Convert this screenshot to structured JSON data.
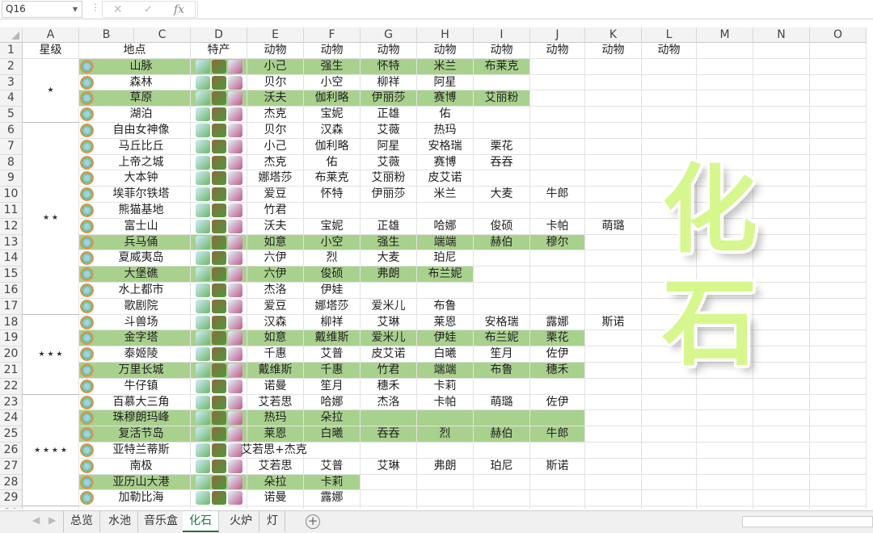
{
  "formula_bar": {
    "name_box": "Q16",
    "cancel": "✕",
    "enter": "✓",
    "fx": "fx"
  },
  "columns": [
    "A",
    "B",
    "C",
    "D",
    "E",
    "F",
    "G",
    "H",
    "I",
    "J",
    "K",
    "L",
    "M",
    "N",
    "O"
  ],
  "header_row": {
    "star": "星级",
    "place": "地点",
    "specialty": "特产",
    "animal": "动物",
    "animal_cols": 8
  },
  "star_groups": [
    {
      "label": "★",
      "from": 2,
      "to": 5
    },
    {
      "label": "★ ★",
      "from": 6,
      "to": 17
    },
    {
      "label": "★ ★ ★",
      "from": 18,
      "to": 22
    },
    {
      "label": "★ ★ ★ ★",
      "from": 23,
      "to": 29
    }
  ],
  "rows": [
    {
      "place": "山脉",
      "animals": [
        "小己",
        "强生",
        "怀特",
        "米兰",
        "布莱克"
      ],
      "highlight_through": "I"
    },
    {
      "place": "森林",
      "animals": [
        "贝尔",
        "小空",
        "柳祥",
        "阿星"
      ]
    },
    {
      "place": "草原",
      "animals": [
        "沃夫",
        "伽利略",
        "伊丽莎",
        "赛博",
        "艾丽粉"
      ],
      "highlight_through": "I"
    },
    {
      "place": "湖泊",
      "animals": [
        "杰克",
        "宝妮",
        "正雄",
        "佑"
      ]
    },
    {
      "place": "自由女神像",
      "animals": [
        "贝尔",
        "汉森",
        "艾薇",
        "热玛"
      ]
    },
    {
      "place": "马丘比丘",
      "animals": [
        "小己",
        "伽利略",
        "阿星",
        "安格瑞",
        "栗花"
      ]
    },
    {
      "place": "上帝之城",
      "animals": [
        "杰克",
        "佑",
        "艾薇",
        "赛博",
        "吞吞"
      ]
    },
    {
      "place": "大本钟",
      "animals": [
        "娜塔莎",
        "布莱克",
        "艾丽粉",
        "皮艾诺"
      ]
    },
    {
      "place": "埃菲尔铁塔",
      "animals": [
        "爱豆",
        "怀特",
        "伊丽莎",
        "米兰",
        "大麦",
        "牛郎"
      ]
    },
    {
      "place": "熊猫基地",
      "animals": [
        "竹君"
      ]
    },
    {
      "place": "富士山",
      "animals": [
        "沃夫",
        "宝妮",
        "正雄",
        "哈娜",
        "俊硕",
        "卡帕",
        "萌璐"
      ]
    },
    {
      "place": "兵马俑",
      "animals": [
        "如意",
        "小空",
        "强生",
        "端端",
        "赫伯",
        "穆尔"
      ],
      "highlight_through": "J"
    },
    {
      "place": "夏威夷岛",
      "animals": [
        "六伊",
        "烈",
        "大麦",
        "珀尼"
      ]
    },
    {
      "place": "大堡礁",
      "animals": [
        "六伊",
        "俊硕",
        "弗朗",
        "布兰妮"
      ],
      "highlight_through": "H"
    },
    {
      "place": "水上都市",
      "animals": [
        "杰洛",
        "伊娃"
      ]
    },
    {
      "place": "歌剧院",
      "animals": [
        "爱豆",
        "娜塔莎",
        "爱米儿",
        "布鲁"
      ]
    },
    {
      "place": "斗兽场",
      "animals": [
        "汉森",
        "柳祥",
        "艾琳",
        "莱恩",
        "安格瑞",
        "露娜",
        "斯诺"
      ]
    },
    {
      "place": "金字塔",
      "animals": [
        "如意",
        "戴维斯",
        "爱米儿",
        "伊娃",
        "布兰妮",
        "栗花"
      ],
      "highlight_through": "J"
    },
    {
      "place": "泰姬陵",
      "animals": [
        "千惠",
        "艾普",
        "皮艾诺",
        "白曦",
        "笙月",
        "佐伊"
      ]
    },
    {
      "place": "万里长城",
      "animals": [
        "戴维斯",
        "千惠",
        "竹君",
        "端端",
        "布鲁",
        "穗禾"
      ],
      "highlight_through": "J"
    },
    {
      "place": "牛仔镇",
      "animals": [
        "诺曼",
        "笙月",
        "穗禾",
        "卡莉"
      ]
    },
    {
      "place": "百慕大三角",
      "animals": [
        "艾若思",
        "哈娜",
        "杰洛",
        "卡帕",
        "萌璐",
        "佐伊"
      ]
    },
    {
      "place": "珠穆朗玛峰",
      "animals": [
        "热玛",
        "朵拉"
      ],
      "highlight_through": "J"
    },
    {
      "place": "复活节岛",
      "animals": [
        "莱恩",
        "白曦",
        "吞吞",
        "烈",
        "赫伯",
        "牛郎"
      ],
      "highlight_through": "J"
    },
    {
      "place": "亚特兰蒂斯",
      "animals": [],
      "note": "艾若思+杰克"
    },
    {
      "place": "南极",
      "animals": [
        "艾若思",
        "艾普",
        "艾琳",
        "弗朗",
        "珀尼",
        "斯诺"
      ]
    },
    {
      "place": "亚历山大港",
      "animals": [
        "朵拉",
        "卡莉"
      ],
      "highlight_through": "F"
    },
    {
      "place": "加勒比海",
      "animals": [
        "诺曼",
        "露娜"
      ]
    }
  ],
  "overlay_title": [
    "化",
    "石"
  ],
  "sheet_tabs": [
    "总览",
    "水池",
    "音乐盒",
    "化石",
    "火炉",
    "灯"
  ],
  "active_tab": "化石",
  "add_sheet": "+",
  "colors": {
    "highlight": "#a9d18e",
    "title": "#d6f78e",
    "active_tab": "#217346"
  }
}
